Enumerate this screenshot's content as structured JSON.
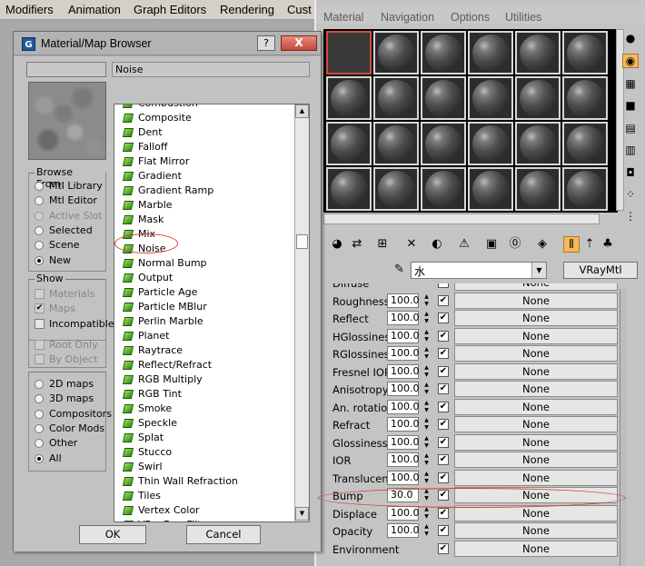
{
  "main_menu": [
    "Modifiers",
    "Animation",
    "Graph Editors",
    "Rendering",
    "Cust"
  ],
  "material_editor": {
    "menu": [
      "Material",
      "Navigation",
      "Options",
      "Utilities"
    ],
    "slots_rows": 4,
    "slots_cols": 6,
    "selected_slot": 0,
    "material_name": "水",
    "material_type": "VRayMtl",
    "params": [
      {
        "label": "Diffuse",
        "value": "",
        "checked": true,
        "map": "None"
      },
      {
        "label": "Roughness",
        "value": "100.0",
        "checked": true,
        "map": "None"
      },
      {
        "label": "Reflect",
        "value": "100.0",
        "checked": true,
        "map": "None"
      },
      {
        "label": "HGlossiness",
        "value": "100.0",
        "checked": true,
        "map": "None"
      },
      {
        "label": "RGlossiness",
        "value": "100.0",
        "checked": true,
        "map": "None"
      },
      {
        "label": "Fresnel IOR",
        "value": "100.0",
        "checked": true,
        "map": "None"
      },
      {
        "label": "Anisotropy",
        "value": "100.0",
        "checked": true,
        "map": "None"
      },
      {
        "label": "An. rotation",
        "value": "100.0",
        "checked": true,
        "map": "None"
      },
      {
        "label": "Refract",
        "value": "100.0",
        "checked": true,
        "map": "None"
      },
      {
        "label": "Glossiness",
        "value": "100.0",
        "checked": true,
        "map": "None"
      },
      {
        "label": "IOR",
        "value": "100.0",
        "checked": true,
        "map": "None"
      },
      {
        "label": "Translucent",
        "value": "100.0",
        "checked": true,
        "map": "None"
      },
      {
        "label": "Bump",
        "value": "30.0",
        "checked": true,
        "map": "None"
      },
      {
        "label": "Displace",
        "value": "100.0",
        "checked": true,
        "map": "None"
      },
      {
        "label": "Opacity",
        "value": "100.0",
        "checked": true,
        "map": "None"
      },
      {
        "label": "Environment",
        "value": "",
        "checked": true,
        "map": "None"
      }
    ]
  },
  "browser": {
    "title": "Material/Map Browser",
    "help": "?",
    "close": "X",
    "selected_name": "Noise",
    "browse_from": {
      "title": "Browse From:",
      "options": [
        {
          "label": "Mtl Library",
          "selected": false,
          "disabled": false
        },
        {
          "label": "Mtl Editor",
          "selected": false,
          "disabled": false
        },
        {
          "label": "Active Slot",
          "selected": false,
          "disabled": true
        },
        {
          "label": "Selected",
          "selected": false,
          "disabled": false
        },
        {
          "label": "Scene",
          "selected": false,
          "disabled": false
        },
        {
          "label": "New",
          "selected": true,
          "disabled": false
        }
      ]
    },
    "show": {
      "title": "Show",
      "checks": [
        {
          "label": "Materials",
          "checked": false,
          "disabled": true
        },
        {
          "label": "Maps",
          "checked": true,
          "disabled": true
        },
        {
          "label": "Incompatible",
          "checked": false,
          "disabled": false
        }
      ],
      "checks2": [
        {
          "label": "Root Only",
          "checked": false,
          "disabled": true
        },
        {
          "label": "By Object",
          "checked": false,
          "disabled": true
        }
      ]
    },
    "map_filter": [
      {
        "label": "2D maps",
        "selected": false
      },
      {
        "label": "3D maps",
        "selected": false
      },
      {
        "label": "Compositors",
        "selected": false
      },
      {
        "label": "Color Mods",
        "selected": false
      },
      {
        "label": "Other",
        "selected": false
      },
      {
        "label": "All",
        "selected": true
      }
    ],
    "list_items": [
      "Combustion",
      "Composite",
      "Dent",
      "Falloff",
      "Flat Mirror",
      "Gradient",
      "Gradient Ramp",
      "Marble",
      "Mask",
      "Mix",
      "Noise",
      "Normal Bump",
      "Output",
      "Particle Age",
      "Particle MBlur",
      "Perlin Marble",
      "Planet",
      "Raytrace",
      "Reflect/Refract",
      "RGB Multiply",
      "RGB Tint",
      "Smoke",
      "Speckle",
      "Splat",
      "Stucco",
      "Swirl",
      "Thin Wall Refraction",
      "Tiles",
      "Vertex Color",
      "VRayBmpFilter"
    ],
    "ok": "OK",
    "cancel": "Cancel"
  }
}
